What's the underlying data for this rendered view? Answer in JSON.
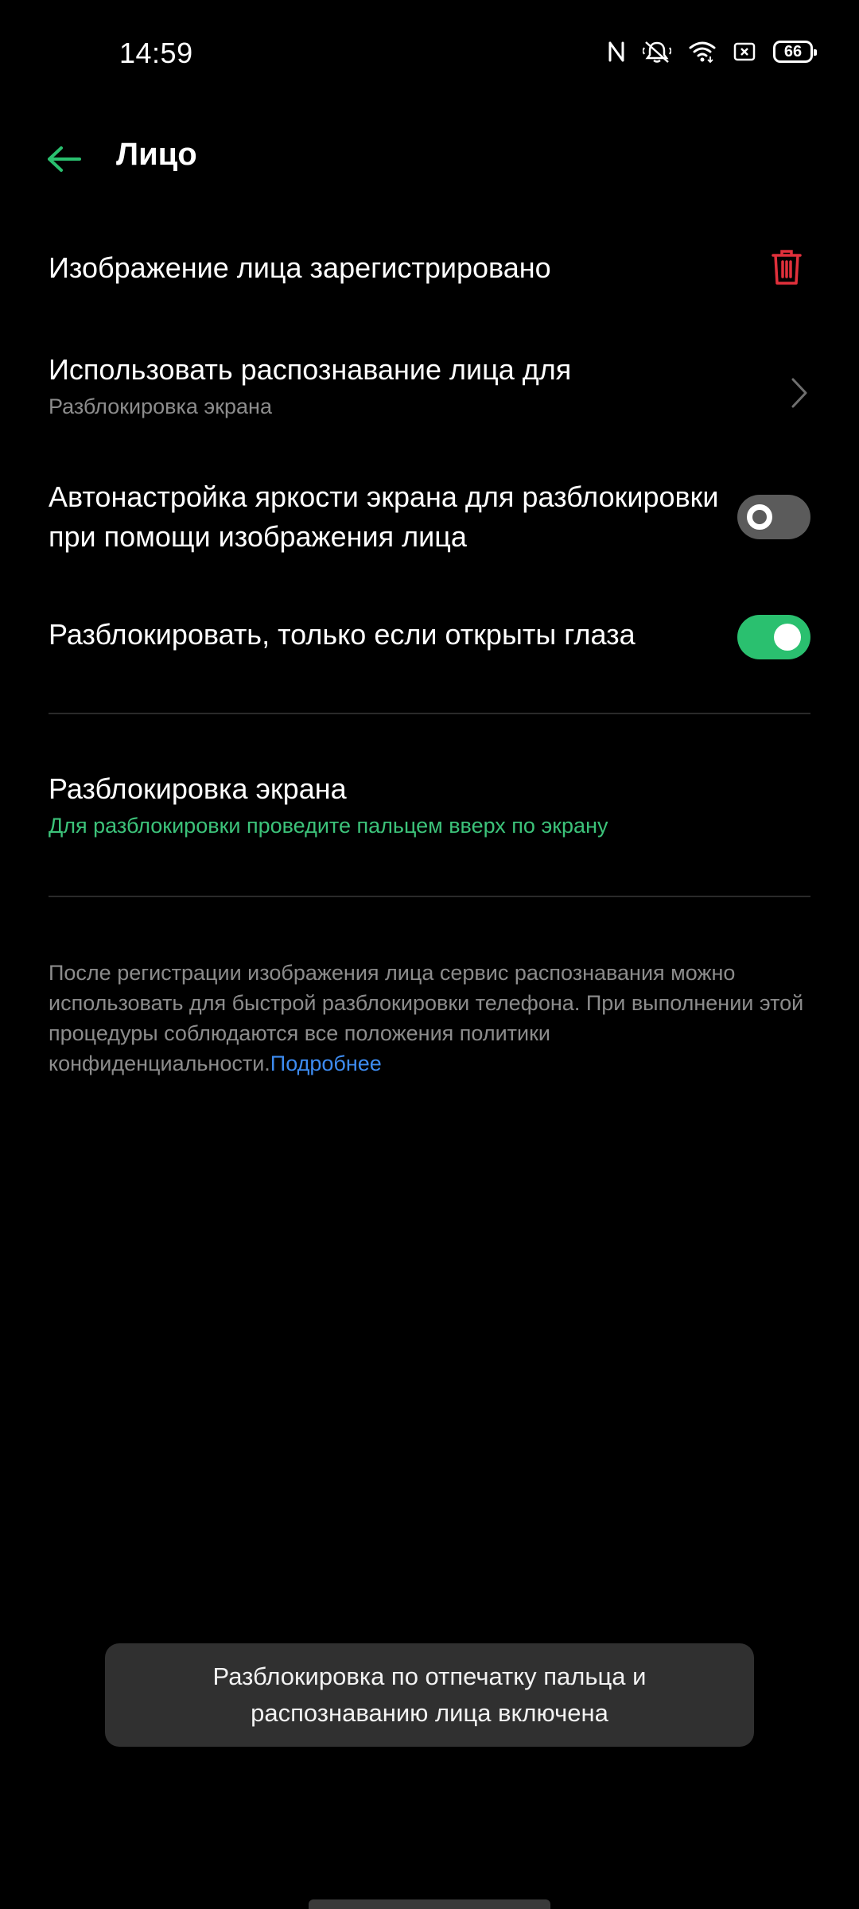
{
  "status_bar": {
    "time": "14:59",
    "battery": "66",
    "icons": [
      "nfc-icon",
      "vibrate-icon",
      "wifi-icon",
      "sim-icon",
      "battery-icon"
    ]
  },
  "toolbar": {
    "title": "Лицо",
    "back_icon": "back-arrow-icon"
  },
  "settings": {
    "registered": {
      "title": "Изображение лица зарегистрировано",
      "action_icon": "trash-icon"
    },
    "use_for": {
      "title": "Использовать распознавание лица для",
      "subtitle": "Разблокировка экрана",
      "action_icon": "chevron-right-icon"
    },
    "auto_brightness": {
      "title": "Автонастройка яркости экрана для разблокировки при помощи изображения лица",
      "enabled": false
    },
    "eyes_open": {
      "title": "Разблокировать, только если открыты глаза",
      "enabled": true
    },
    "lock_screen": {
      "title": "Разблокировка экрана",
      "subtitle": "Для разблокировки проведите пальцем вверх по экрану"
    }
  },
  "footnote": {
    "text": "После регистрации изображения лица сервис распознавания можно использовать для быстрой разблокировки телефона. При выполнении этой процедуры соблюдаются все положения политики конфиденциальности.",
    "link": "Подробнее"
  },
  "toast": {
    "text": "Разблокировка по отпечатку пальца и распознаванию лица включена"
  },
  "colors": {
    "background": "#000000",
    "accent_green": "#2ac06f",
    "danger_red": "#e0303b",
    "link_blue": "#3d8bf0",
    "secondary_text": "#8c8c8c"
  }
}
